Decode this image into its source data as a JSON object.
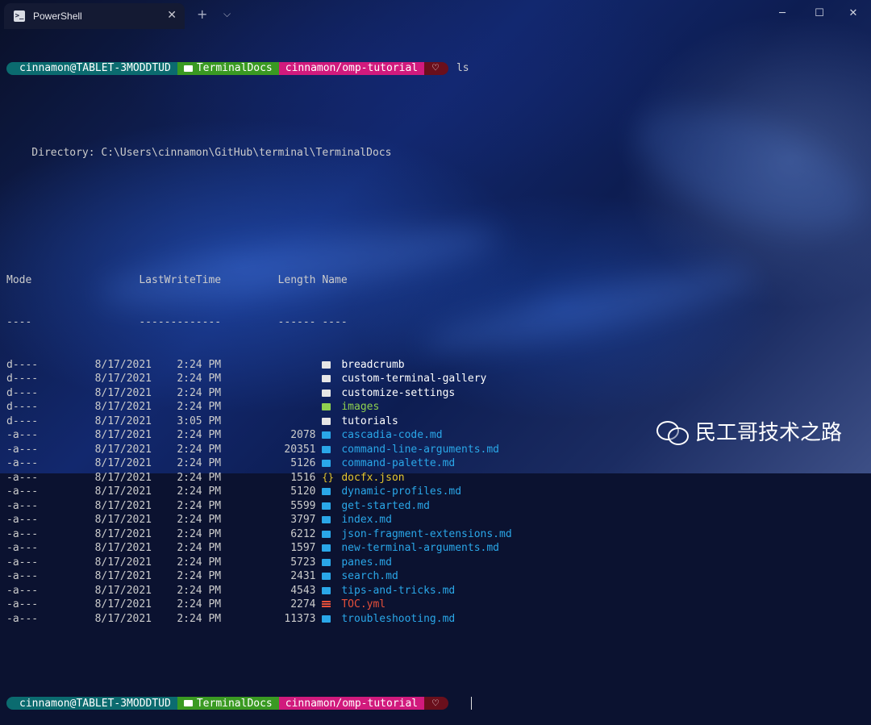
{
  "window": {
    "tab_title": "PowerShell",
    "tab_close": "✕",
    "new_tab": "+",
    "dropdown": "⌵",
    "minimize": "─",
    "maximize": "☐",
    "close": "✕"
  },
  "prompt": {
    "user": "cinnamon@TABLET-3MODDTUD",
    "path": "TerminalDocs",
    "branch": "cinnamon/omp-tutorial",
    "heart": "♡",
    "command": "ls"
  },
  "listing": {
    "directory_label": "    Directory: C:\\Users\\cinnamon\\GitHub\\terminal\\TerminalDocs",
    "header": "Mode                 LastWriteTime         Length Name",
    "underline": "----                 -------------         ------ ----",
    "rows": [
      {
        "mode": "d----",
        "date": "8/17/2021",
        "time": "2:24 PM",
        "length": "",
        "name": "breadcrumb",
        "kind": "dir"
      },
      {
        "mode": "d----",
        "date": "8/17/2021",
        "time": "2:24 PM",
        "length": "",
        "name": "custom-terminal-gallery",
        "kind": "dir"
      },
      {
        "mode": "d----",
        "date": "8/17/2021",
        "time": "2:24 PM",
        "length": "",
        "name": "customize-settings",
        "kind": "dir"
      },
      {
        "mode": "d----",
        "date": "8/17/2021",
        "time": "2:24 PM",
        "length": "",
        "name": "images",
        "kind": "img"
      },
      {
        "mode": "d----",
        "date": "8/17/2021",
        "time": "3:05 PM",
        "length": "",
        "name": "tutorials",
        "kind": "dir"
      },
      {
        "mode": "-a---",
        "date": "8/17/2021",
        "time": "2:24 PM",
        "length": "2078",
        "name": "cascadia-code.md",
        "kind": "md"
      },
      {
        "mode": "-a---",
        "date": "8/17/2021",
        "time": "2:24 PM",
        "length": "20351",
        "name": "command-line-arguments.md",
        "kind": "md"
      },
      {
        "mode": "-a---",
        "date": "8/17/2021",
        "time": "2:24 PM",
        "length": "5126",
        "name": "command-palette.md",
        "kind": "md"
      },
      {
        "mode": "-a---",
        "date": "8/17/2021",
        "time": "2:24 PM",
        "length": "1516",
        "name": "docfx.json",
        "kind": "json"
      },
      {
        "mode": "-a---",
        "date": "8/17/2021",
        "time": "2:24 PM",
        "length": "5120",
        "name": "dynamic-profiles.md",
        "kind": "md"
      },
      {
        "mode": "-a---",
        "date": "8/17/2021",
        "time": "2:24 PM",
        "length": "5599",
        "name": "get-started.md",
        "kind": "md"
      },
      {
        "mode": "-a---",
        "date": "8/17/2021",
        "time": "2:24 PM",
        "length": "3797",
        "name": "index.md",
        "kind": "md"
      },
      {
        "mode": "-a---",
        "date": "8/17/2021",
        "time": "2:24 PM",
        "length": "6212",
        "name": "json-fragment-extensions.md",
        "kind": "md"
      },
      {
        "mode": "-a---",
        "date": "8/17/2021",
        "time": "2:24 PM",
        "length": "1597",
        "name": "new-terminal-arguments.md",
        "kind": "md"
      },
      {
        "mode": "-a---",
        "date": "8/17/2021",
        "time": "2:24 PM",
        "length": "5723",
        "name": "panes.md",
        "kind": "md"
      },
      {
        "mode": "-a---",
        "date": "8/17/2021",
        "time": "2:24 PM",
        "length": "2431",
        "name": "search.md",
        "kind": "md"
      },
      {
        "mode": "-a---",
        "date": "8/17/2021",
        "time": "2:24 PM",
        "length": "4543",
        "name": "tips-and-tricks.md",
        "kind": "md"
      },
      {
        "mode": "-a---",
        "date": "8/17/2021",
        "time": "2:24 PM",
        "length": "2274",
        "name": "TOC.yml",
        "kind": "yml"
      },
      {
        "mode": "-a---",
        "date": "8/17/2021",
        "time": "2:24 PM",
        "length": "11373",
        "name": "troubleshooting.md",
        "kind": "md"
      }
    ]
  },
  "watermark": "民工哥技术之路",
  "colors": {
    "user_segment": "#0b6b6f",
    "path_segment": "#3a9a22",
    "git_segment": "#d11a7d",
    "end_segment": "#6a0f1c",
    "md_files": "#2aa7e8",
    "json_files": "#e5c62e",
    "yml_files": "#e8503a",
    "image_folder": "#8fd14f"
  }
}
